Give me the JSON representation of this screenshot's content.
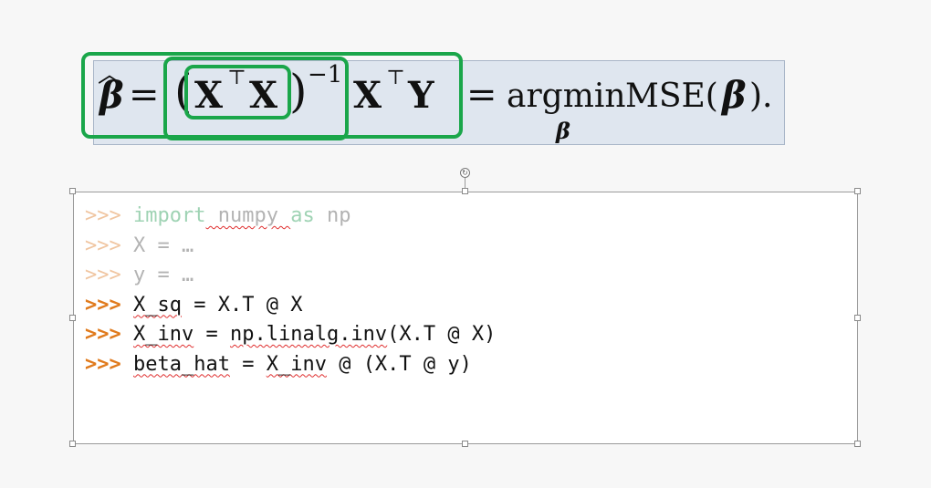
{
  "equation": {
    "beta": "β",
    "hat": "︿",
    "equals": "=",
    "open_paren": "(",
    "x_bold": "X",
    "transpose": "⊤",
    "close_paren": ")",
    "inverse": "−1",
    "y_bold": "Y",
    "argmin": "argmin",
    "mse": "MSE(",
    "mse_close": ").",
    "sub_beta": "β"
  },
  "annotation_color": "#1aa64a",
  "rotate_glyph": "↻",
  "code": {
    "prompt": ">>>",
    "lines": [
      {
        "kw1": "import",
        "mid": " numpy ",
        "kw2": "as",
        "rest": " np"
      },
      {
        "text": " X = …"
      },
      {
        "text": " y = …"
      },
      {
        "a": "X_sq",
        "b": " = X.T @ X"
      },
      {
        "a": "X_inv",
        "b": " = ",
        "c": "np.linalg.inv",
        "d": "(X.T @ X)"
      },
      {
        "a": "beta_hat",
        "b": " = ",
        "c": "X_inv",
        "d": " @ (X.T @ y)"
      }
    ]
  }
}
